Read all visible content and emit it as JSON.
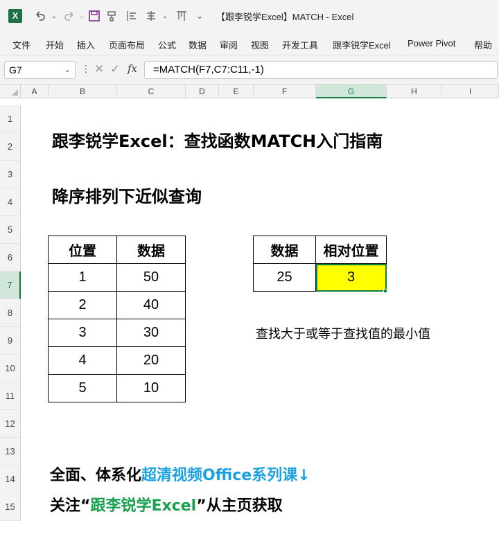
{
  "window": {
    "title": "【跟李锐学Excel】MATCH  -  Excel",
    "app_icon_letter": "X"
  },
  "quick_access": [
    "undo-icon",
    "redo-icon",
    "save-icon",
    "format-painter-icon",
    "align-icon",
    "align-center-icon",
    "filter-icon",
    "customize-icon"
  ],
  "ribbon": {
    "tabs": [
      "文件",
      "开始",
      "插入",
      "页面布局",
      "公式",
      "数据",
      "审阅",
      "视图",
      "开发工具",
      "跟李锐学Excel",
      "Power Pivot",
      "帮助"
    ]
  },
  "formula_bar": {
    "name_box": "G7",
    "sep": "⋮",
    "cancel": "✕",
    "enter": "✓",
    "fx": "fx",
    "formula": "=MATCH(F7,C7:C11,-1)"
  },
  "grid": {
    "columns": [
      "A",
      "B",
      "C",
      "D",
      "E",
      "F",
      "G",
      "H",
      "I"
    ],
    "active_column": "G",
    "rows": [
      "1",
      "2",
      "3",
      "4",
      "5",
      "6",
      "7",
      "8",
      "9",
      "10",
      "11",
      "12",
      "13",
      "14",
      "15"
    ],
    "active_row": "7"
  },
  "content": {
    "title": "跟李锐学Excel：查找函数MATCH入门指南",
    "subtitle": "降序排列下近似查询",
    "table1": {
      "headers": [
        "位置",
        "数据"
      ],
      "rows": [
        [
          "1",
          "50"
        ],
        [
          "2",
          "40"
        ],
        [
          "3",
          "30"
        ],
        [
          "4",
          "20"
        ],
        [
          "5",
          "10"
        ]
      ]
    },
    "table2": {
      "headers": [
        "数据",
        "相对位置"
      ],
      "value": "25",
      "result": "3"
    },
    "note": "查找大于或等于查找值的最小值",
    "promo1_black": "全面、体系化",
    "promo1_blue": "超清视频Office系列课↓",
    "promo2_a": "关注“",
    "promo2_green": "跟李锐学Excel",
    "promo2_b": "”从主页获取"
  },
  "colors": {
    "excel_green": "#107c41",
    "highlight": "#ffff00",
    "promo_blue": "#1ba1e2",
    "promo_green": "#1aa14f"
  }
}
